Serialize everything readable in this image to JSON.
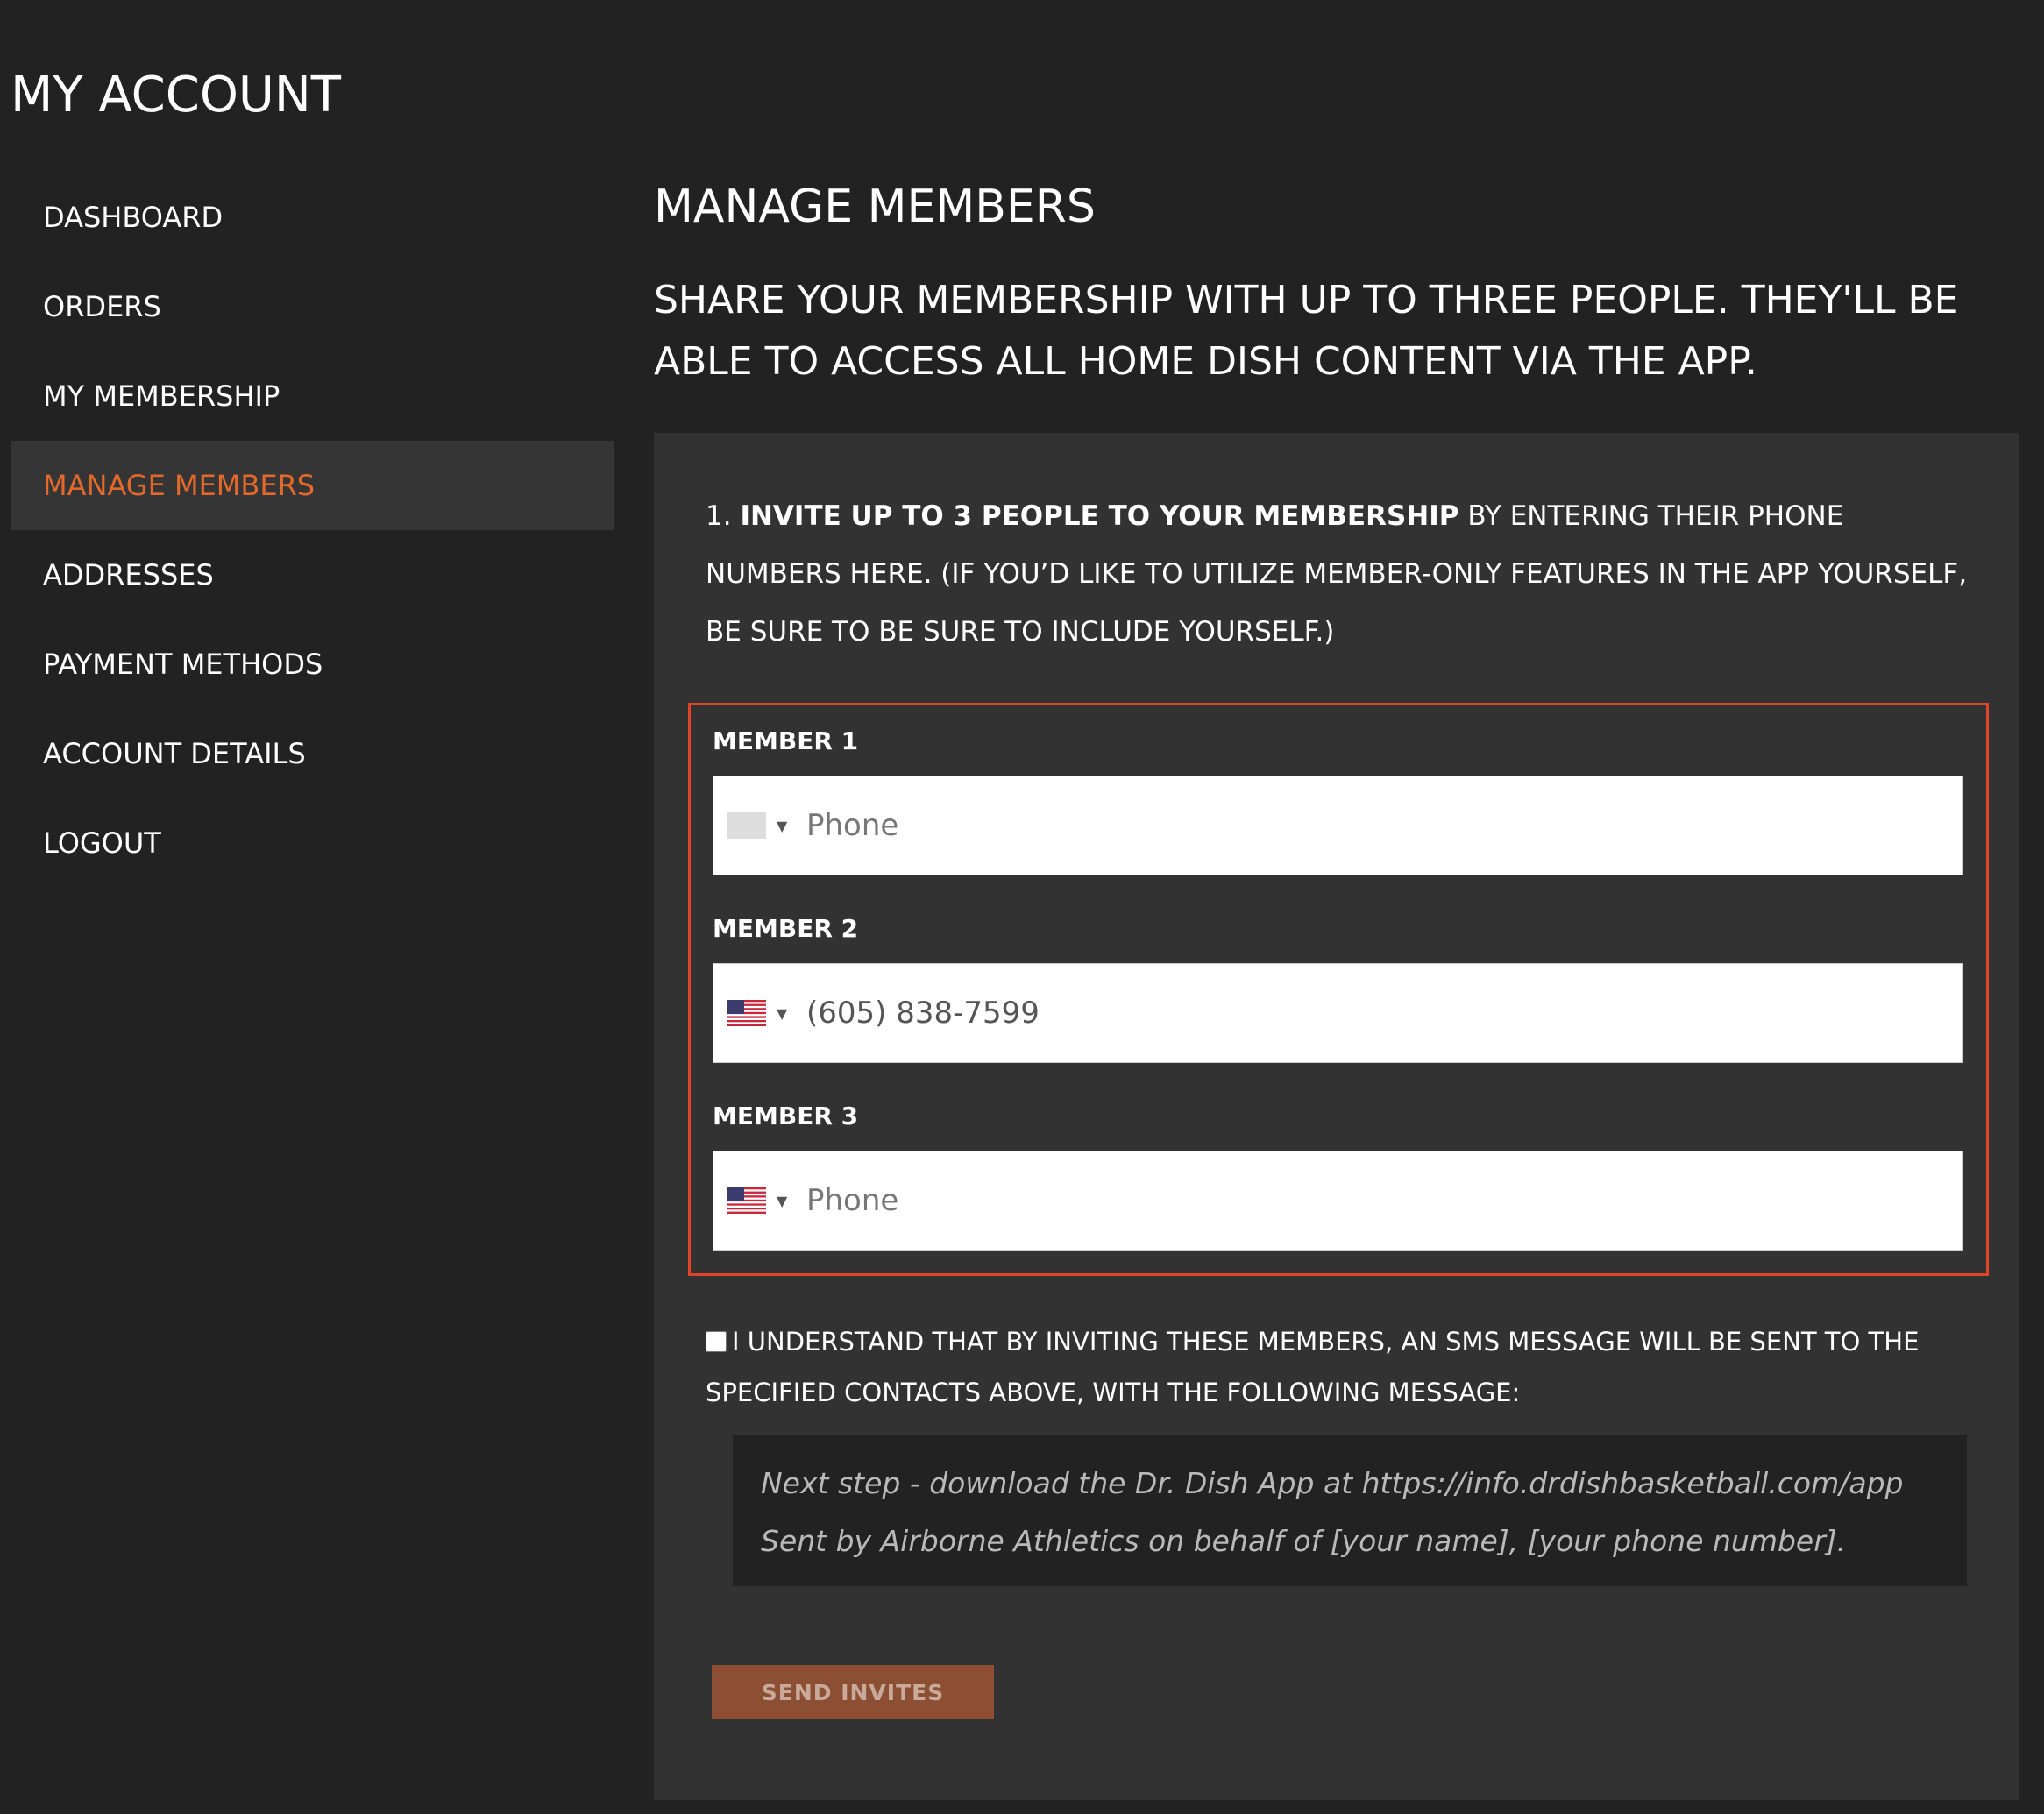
{
  "account": {
    "title": "MY ACCOUNT"
  },
  "sidebar": {
    "items": [
      {
        "label": "DASHBOARD"
      },
      {
        "label": "ORDERS"
      },
      {
        "label": "MY MEMBERSHIP"
      },
      {
        "label": "MANAGE MEMBERS",
        "active": true
      },
      {
        "label": "ADDRESSES"
      },
      {
        "label": "PAYMENT METHODS"
      },
      {
        "label": "ACCOUNT DETAILS"
      },
      {
        "label": "LOGOUT"
      }
    ]
  },
  "main": {
    "title": "MANAGE MEMBERS",
    "intro": "SHARE YOUR MEMBERSHIP WITH UP TO THREE PEOPLE. THEY'LL BE ABLE TO ACCESS ALL HOME DISH CONTENT VIA THE APP.",
    "instructions": {
      "prefix": "1. ",
      "bold": "INVITE UP TO 3 PEOPLE TO YOUR MEMBERSHIP",
      "rest": " BY ENTERING THEIR PHONE NUMBERS HERE. (IF YOU’D LIKE TO UTILIZE MEMBER-ONLY FEATURES IN THE APP YOURSELF, BE SURE TO BE SURE TO INCLUDE YOURSELF.)"
    },
    "members": [
      {
        "label": "MEMBER 1",
        "value": "",
        "placeholder": "Phone",
        "flag": "blank-flag"
      },
      {
        "label": "MEMBER 2",
        "value": "(605) 838-7599",
        "placeholder": "Phone",
        "flag": "us-flag"
      },
      {
        "label": "MEMBER 3",
        "value": "",
        "placeholder": "Phone",
        "flag": "us-flag"
      }
    ],
    "consent": "I UNDERSTAND THAT BY INVITING THESE MEMBERS, AN SMS MESSAGE WILL BE SENT TO THE SPECIFIED CONTACTS ABOVE, WITH THE FOLLOWING MESSAGE:",
    "message": {
      "line1": "Next step - download the Dr. Dish App at https://info.drdishbasketball.com/app",
      "line2": "Sent by Airborne Athletics on behalf of [your name], [your phone number]."
    },
    "send_label": "SEND INVITES"
  },
  "colors": {
    "background": "#222222",
    "panel": "#323232",
    "accent": "#e2692b",
    "highlight_border": "#e0442a",
    "button": "#8c4f34"
  }
}
